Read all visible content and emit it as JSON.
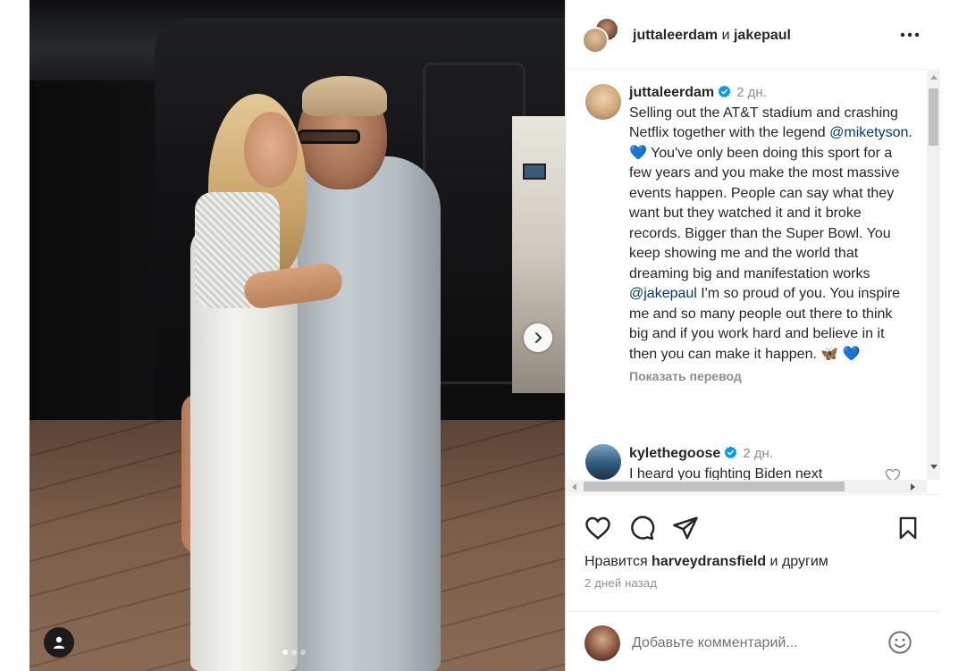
{
  "post_header": {
    "user1": "juttaleerdam",
    "connector": " и ",
    "user2": "jakepaul"
  },
  "caption": {
    "username": "juttaleerdam",
    "time": "2 дн.",
    "part1": "Selling out the AT&T stadium and crashing Netflix together with the legend ",
    "mention1": "@miketyson",
    "part2": ". 💙 You've only been doing this sport for a few years and you make the most massive events happen. People can say what they want but they watched it and it broke records. Bigger than the Super Bowl. You keep showing me and the world that dreaming big and manifestation works ",
    "mention2": "@jakepaul",
    "part3": " I'm so proud of you. You inspire me and so many people out there to think big and if you work hard and believe in it then you can make it happen. 🦋 💙",
    "translate": "Показать перевод"
  },
  "comment2": {
    "username": "kylethegoose",
    "time": "2 дн.",
    "text": "I heard you fighting Biden next"
  },
  "likes": {
    "prefix": "Нравится ",
    "user": "harveydransfield",
    "suffix": " и другим"
  },
  "date": "2 дней назад",
  "comment_input": {
    "placeholder": "Добавьте комментарий..."
  },
  "carousel": {
    "slide_count": 3,
    "active_index": 0
  },
  "colors": {
    "verified": "#0095f6",
    "mention": "#00376b",
    "secondary_text": "#8e8e8e"
  }
}
